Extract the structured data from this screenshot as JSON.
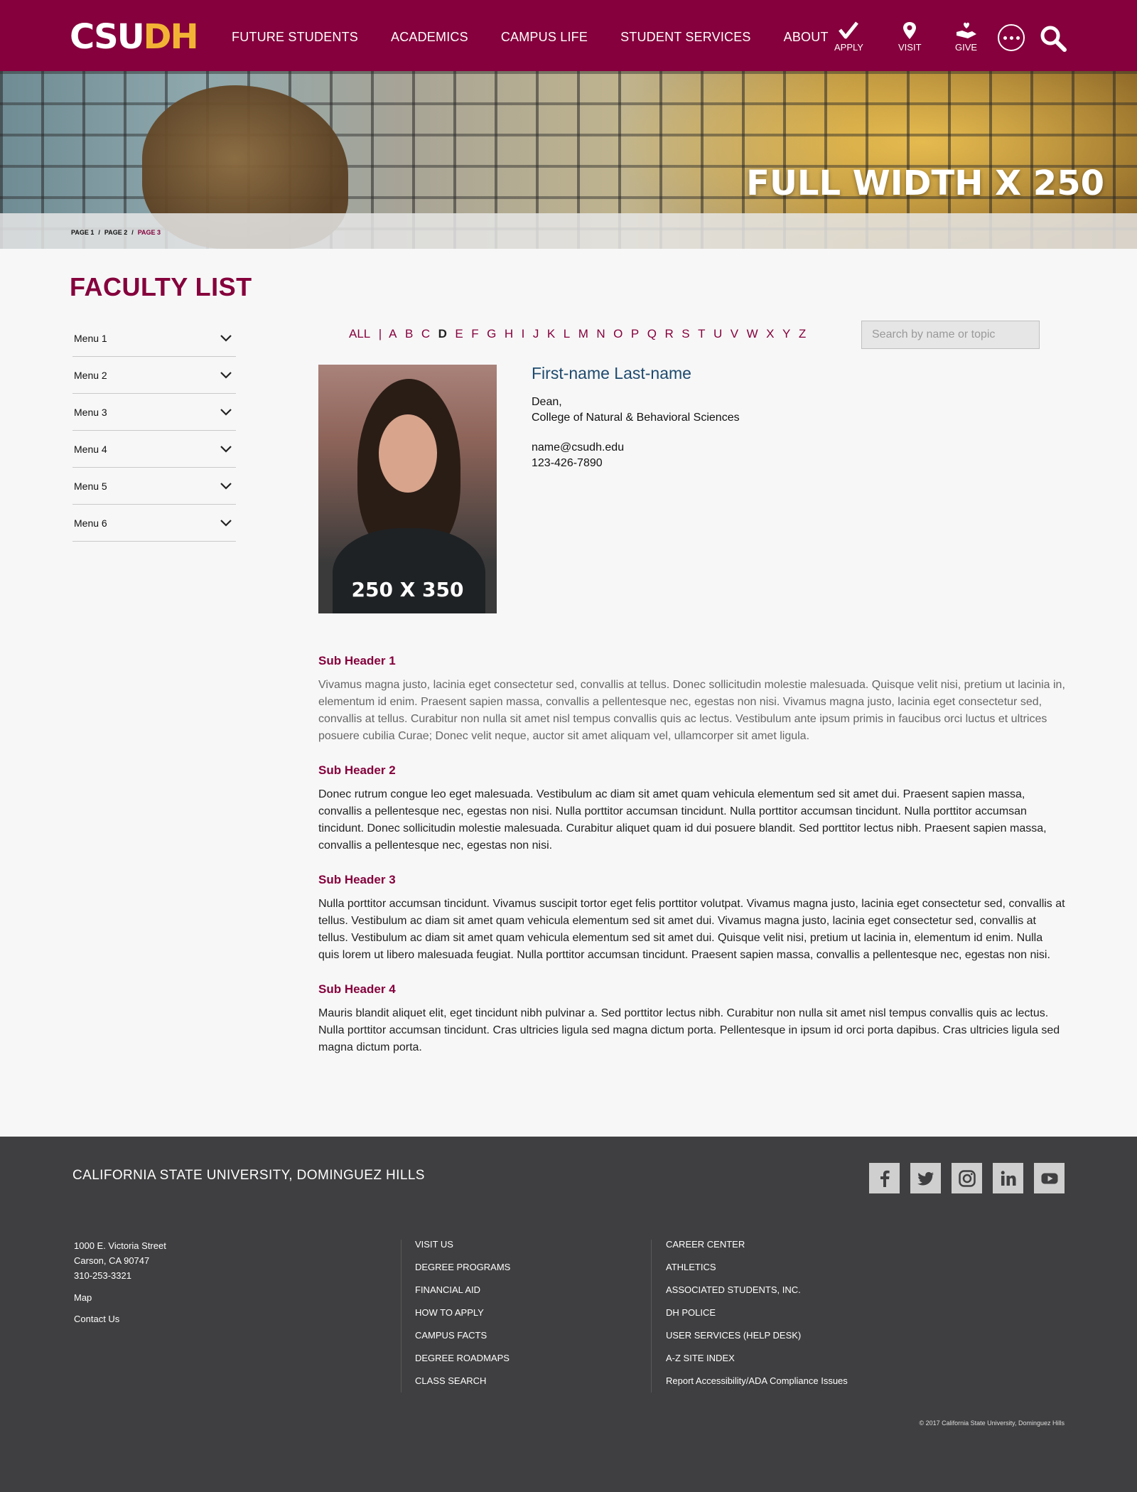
{
  "header": {
    "logo_part1": "CSU",
    "logo_part2": "DH",
    "nav": [
      "FUTURE STUDENTS",
      "ACADEMICS",
      "CAMPUS LIFE",
      "STUDENT SERVICES",
      "ABOUT"
    ],
    "quick_links": [
      {
        "label": "APPLY",
        "icon": "checkmark-icon"
      },
      {
        "label": "VISIT",
        "icon": "map-pin-icon"
      },
      {
        "label": "GIVE",
        "icon": "give-hand-icon"
      }
    ]
  },
  "hero": {
    "title": "FULL WIDTH X 250",
    "breadcrumb": [
      "PAGE 1",
      "PAGE 2",
      "PAGE 3"
    ]
  },
  "main": {
    "page_title": "FACULTY LIST",
    "side_menu": [
      "Menu 1",
      "Menu 2",
      "Menu 3",
      "Menu 4",
      "Menu 5",
      "Menu 6"
    ],
    "alpha_filter": {
      "all": "ALL",
      "letters": [
        "A",
        "B",
        "C",
        "D",
        "E",
        "F",
        "G",
        "H",
        "I",
        "J",
        "K",
        "L",
        "M",
        "N",
        "O",
        "P",
        "Q",
        "R",
        "S",
        "T",
        "U",
        "V",
        "W",
        "X",
        "Y",
        "Z"
      ],
      "active": "D"
    },
    "search_placeholder": "Search by name or topic",
    "profile": {
      "photo_label": "250 X 350",
      "name": "First-name Last-name",
      "title_line1": "Dean,",
      "title_line2": "College of Natural & Behavioral Sciences",
      "email": "name@csudh.edu",
      "phone": "123-426-7890"
    },
    "sections": [
      {
        "header": "Sub Header 1",
        "body": "Vivamus magna justo, lacinia eget consectetur sed, convallis at tellus. Donec sollicitudin molestie malesuada. Quisque velit nisi, pretium ut lacinia in, elementum id enim. Praesent sapien massa, convallis a pellentesque nec, egestas non nisi. Vivamus magna justo, lacinia eget consectetur sed, convallis at tellus. Curabitur non nulla sit amet nisl tempus convallis quis ac lectus. Vestibulum ante ipsum primis in faucibus orci luctus et ultrices posuere cubilia Curae; Donec velit neque, auctor sit amet aliquam vel, ullamcorper sit amet ligula."
      },
      {
        "header": "Sub Header 2",
        "body": "Donec rutrum congue leo eget malesuada. Vestibulum ac diam sit amet quam vehicula elementum sed sit amet dui. Praesent sapien massa, convallis a pellentesque nec, egestas non nisi. Nulla porttitor accumsan tincidunt. Nulla porttitor accumsan tincidunt. Nulla porttitor accumsan tincidunt. Donec sollicitudin molestie malesuada. Curabitur aliquet quam id dui posuere blandit. Sed porttitor lectus nibh. Praesent sapien massa, convallis a pellentesque nec, egestas non nisi."
      },
      {
        "header": "Sub Header 3",
        "body": "Nulla porttitor accumsan tincidunt. Vivamus suscipit tortor eget felis porttitor volutpat. Vivamus magna justo, lacinia eget consectetur sed, convallis at tellus. Vestibulum ac diam sit amet quam vehicula elementum sed sit amet dui. Vivamus magna justo, lacinia eget consectetur sed, convallis at tellus. Vestibulum ac diam sit amet quam vehicula elementum sed sit amet dui. Quisque velit nisi, pretium ut lacinia in, elementum id enim. Nulla quis lorem ut libero malesuada feugiat. Nulla porttitor accumsan tincidunt. Praesent sapien massa, convallis a pellentesque nec, egestas non nisi."
      },
      {
        "header": "Sub Header 4",
        "body": "Mauris blandit aliquet elit, eget tincidunt nibh pulvinar a. Sed porttitor lectus nibh. Curabitur non nulla sit amet nisl tempus convallis quis ac lectus. Nulla porttitor accumsan tincidunt. Cras ultricies ligula sed magna dictum porta. Pellentesque in ipsum id orci porta dapibus. Cras ultricies ligula sed magna dictum porta."
      }
    ]
  },
  "footer": {
    "title": "CALIFORNIA STATE UNIVERSITY, DOMINGUEZ HILLS",
    "social": [
      "facebook-icon",
      "twitter-icon",
      "instagram-icon",
      "linkedin-icon",
      "youtube-icon"
    ],
    "address_line1": "1000 E. Victoria Street",
    "address_line2": "Carson, CA 90747",
    "phone": "310-253-3321",
    "map_link": "Map",
    "contact_link": "Contact Us",
    "col2": [
      "VISIT US",
      "DEGREE PROGRAMS",
      "FINANCIAL AID",
      "HOW TO APPLY",
      "CAMPUS FACTS",
      "DEGREE ROADMAPS",
      "CLASS SEARCH"
    ],
    "col3": [
      "CAREER CENTER",
      "ATHLETICS",
      "ASSOCIATED STUDENTS, INC.",
      "DH POLICE",
      "USER SERVICES (HELP DESK)",
      "A-Z SITE INDEX",
      "Report Accessibility/ADA Compliance Issues"
    ],
    "copyright": "© 2017 California State University, Dominguez Hills"
  },
  "colors": {
    "brand": "#85003c",
    "gold": "#f2b335",
    "footer": "#3f3f41",
    "name_blue": "#1e4a6e"
  }
}
